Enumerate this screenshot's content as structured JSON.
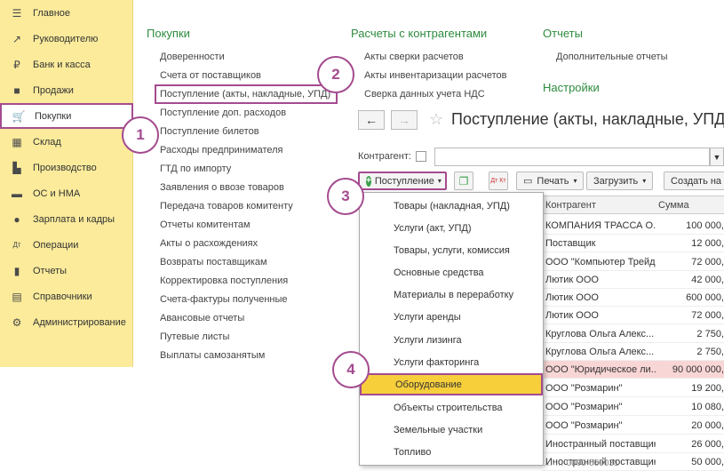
{
  "sidebar": {
    "items": [
      {
        "label": "Главное",
        "icon": "menu-icon"
      },
      {
        "label": "Руководителю",
        "icon": "trend-icon"
      },
      {
        "label": "Банк и касса",
        "icon": "coin-icon"
      },
      {
        "label": "Продажи",
        "icon": "bag-icon"
      },
      {
        "label": "Покупки",
        "icon": "cart-icon"
      },
      {
        "label": "Склад",
        "icon": "warehouse-icon"
      },
      {
        "label": "Производство",
        "icon": "factory-icon"
      },
      {
        "label": "ОС и НМА",
        "icon": "truck-icon"
      },
      {
        "label": "Зарплата и кадры",
        "icon": "person-icon"
      },
      {
        "label": "Операции",
        "icon": "dt-kt-icon"
      },
      {
        "label": "Отчеты",
        "icon": "chart-icon"
      },
      {
        "label": "Справочники",
        "icon": "book-icon"
      },
      {
        "label": "Администрирование",
        "icon": "gear-icon"
      }
    ]
  },
  "sections": {
    "purchases": {
      "title": "Покупки",
      "links": [
        "Доверенности",
        "Счета от поставщиков",
        "Поступление (акты, накладные, УПД)",
        "Поступление доп. расходов",
        "Поступление билетов",
        "Расходы предпринимателя",
        "ГТД по импорту",
        "Заявления о ввозе товаров",
        "Передача товаров комитенту",
        "Отчеты комитентам",
        "Акты о расхождениях",
        "Возвраты поставщикам",
        "Корректировка поступления",
        "Счета-фактуры полученные",
        "Авансовые отчеты",
        "Путевые листы",
        "Выплаты самозанятым"
      ]
    },
    "settlements": {
      "title": "Расчеты с контрагентами",
      "links": [
        "Акты сверки расчетов",
        "Акты инвентаризации расчетов",
        "Сверка данных учета НДС"
      ]
    },
    "reports": {
      "title": "Отчеты",
      "links": [
        "Дополнительные отчеты"
      ]
    },
    "settings": {
      "title": "Настройки"
    }
  },
  "callouts": [
    "1",
    "2",
    "3",
    "4"
  ],
  "document": {
    "title": "Поступление (акты, накладные, УПД)",
    "back": "←",
    "forward": "→",
    "star": "☆",
    "counterparty_label": "Контрагент:",
    "toolbar": {
      "post": "Поступление",
      "print": "Печать",
      "load": "Загрузить",
      "create": "Создать на о",
      "dtkt": "Дт Кт"
    },
    "table": {
      "columns": [
        "Контрагент",
        "Сумма"
      ],
      "rows": [
        {
          "c": "КОМПАНИЯ ТРАССА О...",
          "s": "100 000,"
        },
        {
          "c": "Поставщик",
          "s": "12 000,"
        },
        {
          "c": "ООО \"Компьютер Трейд\"",
          "s": "72 000,"
        },
        {
          "c": "Лютик ООО",
          "s": "42 000,"
        },
        {
          "c": "Лютик ООО",
          "s": "600 000,"
        },
        {
          "c": "Лютик ООО",
          "s": "72 000,"
        },
        {
          "c": "Круглова Ольга Алекс...",
          "s": "2 750,"
        },
        {
          "c": "Круглова Ольга Алекс...",
          "s": "2 750,"
        },
        {
          "c": "ООО \"Юридическое ли...",
          "s": "90 000 000,"
        },
        {
          "c": "ООО \"Розмарин\"",
          "s": "19 200,"
        },
        {
          "c": "ООО \"Розмарин\"",
          "s": "10 080,"
        },
        {
          "c": "ООО \"Розмарин\"",
          "s": "20 000,"
        },
        {
          "c": "Иностранный поставщик",
          "s": "26 000,"
        },
        {
          "c": "Иностранный поставщик",
          "s": "50 000,"
        }
      ]
    },
    "bottom_fragment": "… … 0000-000031"
  },
  "dropdown": {
    "items": [
      "Товары (накладная, УПД)",
      "Услуги (акт, УПД)",
      "Товары, услуги, комиссия",
      "Основные средства",
      "Материалы в переработку",
      "Услуги аренды",
      "Услуги лизинга",
      "Услуги факторинга",
      "Оборудование",
      "Объекты строительства",
      "Земельные участки",
      "Топливо"
    ],
    "selected_index": 8
  },
  "colors": {
    "sidebar_bg": "#fbeb9b",
    "accent_green": "#2e8b3e",
    "callout": "#a44b8f",
    "selected_item": "#f7cf3b",
    "highlight_row": "#f9d6d6"
  }
}
